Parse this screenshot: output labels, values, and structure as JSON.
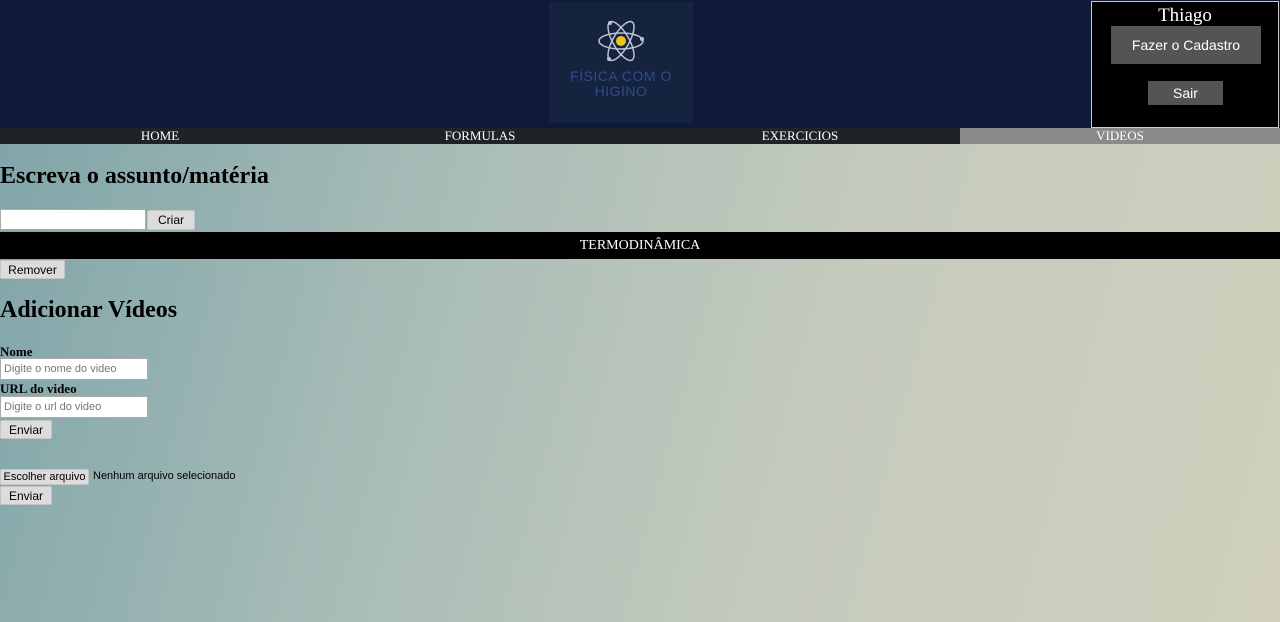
{
  "header": {
    "logo_text_line1": "FÍSICA COM O",
    "logo_text_line2": "HIGINO",
    "logo_icon": "atom-icon",
    "colors": {
      "header_bg": "#0f1938",
      "logo_text": "#2b4c8c",
      "atom_nucleus": "#f0c419"
    }
  },
  "user": {
    "name": "Thiago",
    "signup_label": "Fazer o Cadastro",
    "logout_label": "Sair"
  },
  "nav": {
    "items": [
      {
        "label": "HOME",
        "active": false
      },
      {
        "label": "FORMULAS",
        "active": false
      },
      {
        "label": "EXERCICIOS",
        "active": false
      },
      {
        "label": "VIDEOS",
        "active": true
      }
    ]
  },
  "subject": {
    "title": "Escreva o assunto/matéria",
    "input_value": "",
    "create_label": "Criar",
    "current_subject": "TERMODINÂMICA",
    "remove_label": "Remover"
  },
  "videos": {
    "title": "Adicionar Vídeos",
    "name_label": "Nome",
    "name_placeholder": "Digite o nome do video",
    "url_label": "URL do video",
    "url_placeholder": "Digite o url do video",
    "send_label": "Enviar",
    "file_button_label": "Escolher arquivo",
    "file_status": "Nenhum arquivo selecionado",
    "send_file_label": "Enviar"
  }
}
